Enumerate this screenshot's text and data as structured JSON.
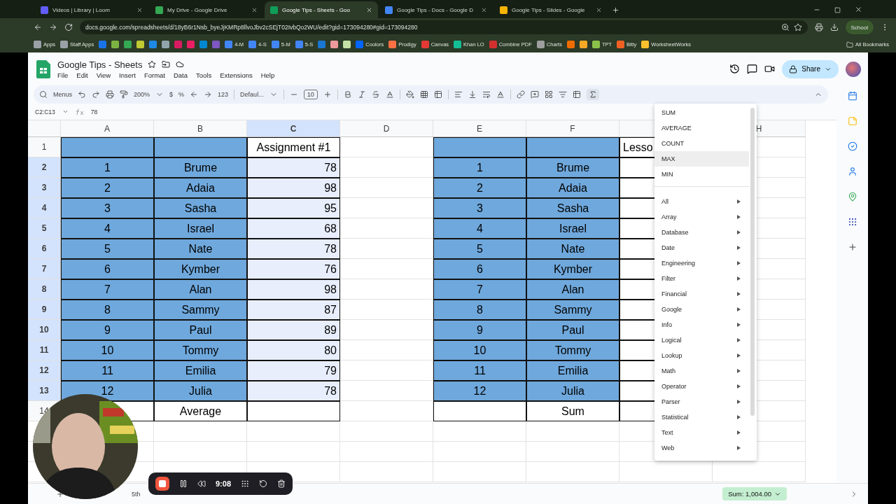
{
  "browser": {
    "tabs": [
      {
        "title": "Videos | Library | Loom",
        "selected": false,
        "color": "#625df5"
      },
      {
        "title": "My Drive - Google Drive",
        "selected": false,
        "color": "#34a853"
      },
      {
        "title": "Google Tips - Sheets - Goo",
        "selected": true,
        "color": "#0f9d58"
      },
      {
        "title": "Google Tips - Docs - Google D",
        "selected": false,
        "color": "#4285f4"
      },
      {
        "title": "Google Tips - Slides - Google",
        "selected": false,
        "color": "#f4b400"
      }
    ],
    "address": "docs.google.com/spreadsheets/d/18yB6r1Nsb_byeJjKMRp8llvoJbv2cSEjT02IvbQo2WU/edit?gid=173094280#gid=173094280",
    "profile": "School",
    "bookmarks": [
      {
        "kind": "link",
        "label": "Apps",
        "color": "#9aa0a6"
      },
      {
        "kind": "link",
        "label": "Staff Apps",
        "color": "#9aa0a6"
      },
      {
        "kind": "icon",
        "color": "#1a73e8"
      },
      {
        "kind": "icon",
        "color": "#7cb342"
      },
      {
        "kind": "icon",
        "color": "#34a853"
      },
      {
        "kind": "icon",
        "color": "#c0ca33"
      },
      {
        "kind": "icon",
        "color": "#1e88e5"
      },
      {
        "kind": "icon",
        "color": "#90a4ae"
      },
      {
        "kind": "icon",
        "color": "#d81b60"
      },
      {
        "kind": "icon",
        "color": "#e91e63"
      },
      {
        "kind": "icon",
        "color": "#0288d1"
      },
      {
        "kind": "icon",
        "color": "#7e57c2"
      },
      {
        "kind": "link",
        "label": "4-M",
        "color": "#4285f4"
      },
      {
        "kind": "link",
        "label": "4-S",
        "color": "#4285f4"
      },
      {
        "kind": "link",
        "label": "5-M",
        "color": "#4285f4"
      },
      {
        "kind": "link",
        "label": "5-S",
        "color": "#4285f4"
      },
      {
        "kind": "icon",
        "color": "#1976d2"
      },
      {
        "kind": "icon",
        "color": "#ef9a9a"
      },
      {
        "kind": "icon",
        "color": "#c5e1a5"
      },
      {
        "kind": "link",
        "label": "Coolors",
        "color": "#0066ff"
      },
      {
        "kind": "link",
        "label": "Prodigy",
        "color": "#ff7043"
      },
      {
        "kind": "link",
        "label": "Canvas",
        "color": "#e53935"
      },
      {
        "kind": "link",
        "label": "Khan LO",
        "color": "#14bf96"
      },
      {
        "kind": "link",
        "label": "Combine PDF",
        "color": "#d32f2f"
      },
      {
        "kind": "link",
        "label": "Charts",
        "color": "#9e9e9e"
      },
      {
        "kind": "icon",
        "color": "#ef6c00"
      },
      {
        "kind": "icon",
        "color": "#f9a825"
      },
      {
        "kind": "link",
        "label": "TPT",
        "color": "#8bc34a"
      },
      {
        "kind": "link",
        "label": "Bitly",
        "color": "#ee6123"
      },
      {
        "kind": "link",
        "label": "WorksheetWorks",
        "color": "#fbc02d"
      }
    ],
    "all_bookmarks": "All Bookmarks"
  },
  "sheets": {
    "title": "Google Tips - Sheets",
    "menus": [
      "File",
      "Edit",
      "View",
      "Insert",
      "Format",
      "Data",
      "Tools",
      "Extensions",
      "Help"
    ],
    "share": "Share",
    "toolbar": {
      "search": "Menus",
      "zoom": "200%",
      "currency": "$",
      "percent": "%",
      "number_format": "123",
      "font": "Defaul...",
      "font_size": "10"
    },
    "name_box": "C2:C13",
    "formula": "78",
    "columns": [
      {
        "label": "A",
        "selected": false
      },
      {
        "label": "B",
        "selected": false
      },
      {
        "label": "C",
        "selected": true
      },
      {
        "label": "D",
        "selected": false
      },
      {
        "label": "E",
        "selected": false
      },
      {
        "label": "F",
        "selected": false
      },
      {
        "selected": false
      },
      {
        "label": "H",
        "selected": false
      }
    ],
    "rows": [
      {
        "number": "1",
        "selected": false,
        "cells": [
          {
            "kind": "blue"
          },
          {
            "kind": "blue"
          },
          {
            "kind": "box",
            "text": "Assignment #1"
          },
          {
            "kind": "empty"
          },
          {
            "kind": "blue"
          },
          {
            "kind": "blue"
          },
          {
            "kind": "label",
            "text": "Lesso"
          },
          {
            "kind": "empty"
          }
        ]
      },
      {
        "number": "2",
        "selected": true,
        "cells": [
          {
            "kind": "blue",
            "text": "1"
          },
          {
            "kind": "blue",
            "text": "Brume"
          },
          {
            "kind": "sel",
            "text": "78"
          },
          {
            "kind": "empty"
          },
          {
            "kind": "blue",
            "text": "1"
          },
          {
            "kind": "blue",
            "text": "Brume"
          },
          {
            "kind": "box"
          },
          {
            "kind": "empty"
          }
        ]
      },
      {
        "number": "3",
        "selected": true,
        "cells": [
          {
            "kind": "blue",
            "text": "2"
          },
          {
            "kind": "blue",
            "text": "Adaia"
          },
          {
            "kind": "sel",
            "text": "98"
          },
          {
            "kind": "empty"
          },
          {
            "kind": "blue",
            "text": "2"
          },
          {
            "kind": "blue",
            "text": "Adaia"
          },
          {
            "kind": "box"
          },
          {
            "kind": "empty"
          }
        ]
      },
      {
        "number": "4",
        "selected": true,
        "cells": [
          {
            "kind": "blue",
            "text": "3"
          },
          {
            "kind": "blue",
            "text": "Sasha"
          },
          {
            "kind": "sel",
            "text": "95"
          },
          {
            "kind": "empty"
          },
          {
            "kind": "blue",
            "text": "3"
          },
          {
            "kind": "blue",
            "text": "Sasha"
          },
          {
            "kind": "box"
          },
          {
            "kind": "empty"
          }
        ]
      },
      {
        "number": "5",
        "selected": true,
        "cells": [
          {
            "kind": "blue",
            "text": "4"
          },
          {
            "kind": "blue",
            "text": "Israel"
          },
          {
            "kind": "sel",
            "text": "68"
          },
          {
            "kind": "empty"
          },
          {
            "kind": "blue",
            "text": "4"
          },
          {
            "kind": "blue",
            "text": "Israel"
          },
          {
            "kind": "box"
          },
          {
            "kind": "empty"
          }
        ]
      },
      {
        "number": "6",
        "selected": true,
        "cells": [
          {
            "kind": "blue",
            "text": "5"
          },
          {
            "kind": "blue",
            "text": "Nate"
          },
          {
            "kind": "sel",
            "text": "78"
          },
          {
            "kind": "empty"
          },
          {
            "kind": "blue",
            "text": "5"
          },
          {
            "kind": "blue",
            "text": "Nate"
          },
          {
            "kind": "box"
          },
          {
            "kind": "empty"
          }
        ]
      },
      {
        "number": "7",
        "selected": true,
        "cells": [
          {
            "kind": "blue",
            "text": "6"
          },
          {
            "kind": "blue",
            "text": "Kymber"
          },
          {
            "kind": "sel",
            "text": "76"
          },
          {
            "kind": "empty"
          },
          {
            "kind": "blue",
            "text": "6"
          },
          {
            "kind": "blue",
            "text": "Kymber"
          },
          {
            "kind": "box"
          },
          {
            "kind": "empty"
          }
        ]
      },
      {
        "number": "8",
        "selected": true,
        "cells": [
          {
            "kind": "blue",
            "text": "7"
          },
          {
            "kind": "blue",
            "text": "Alan"
          },
          {
            "kind": "sel",
            "text": "98"
          },
          {
            "kind": "empty"
          },
          {
            "kind": "blue",
            "text": "7"
          },
          {
            "kind": "blue",
            "text": "Alan"
          },
          {
            "kind": "box"
          },
          {
            "kind": "empty"
          }
        ]
      },
      {
        "number": "9",
        "selected": true,
        "cells": [
          {
            "kind": "blue",
            "text": "8"
          },
          {
            "kind": "blue",
            "text": "Sammy"
          },
          {
            "kind": "sel",
            "text": "87"
          },
          {
            "kind": "empty"
          },
          {
            "kind": "blue",
            "text": "8"
          },
          {
            "kind": "blue",
            "text": "Sammy"
          },
          {
            "kind": "box"
          },
          {
            "kind": "empty"
          }
        ]
      },
      {
        "number": "10",
        "selected": true,
        "cells": [
          {
            "kind": "blue",
            "text": "9"
          },
          {
            "kind": "blue",
            "text": "Paul"
          },
          {
            "kind": "sel",
            "text": "89"
          },
          {
            "kind": "empty"
          },
          {
            "kind": "blue",
            "text": "9"
          },
          {
            "kind": "blue",
            "text": "Paul"
          },
          {
            "kind": "box"
          },
          {
            "kind": "empty"
          }
        ]
      },
      {
        "number": "11",
        "selected": true,
        "cells": [
          {
            "kind": "blue",
            "text": "10"
          },
          {
            "kind": "blue",
            "text": "Tommy"
          },
          {
            "kind": "sel",
            "text": "80"
          },
          {
            "kind": "empty"
          },
          {
            "kind": "blue",
            "text": "10"
          },
          {
            "kind": "blue",
            "text": "Tommy"
          },
          {
            "kind": "box"
          },
          {
            "kind": "empty"
          }
        ]
      },
      {
        "number": "12",
        "selected": true,
        "cells": [
          {
            "kind": "blue",
            "text": "11"
          },
          {
            "kind": "blue",
            "text": "Emilia"
          },
          {
            "kind": "sel",
            "text": "79"
          },
          {
            "kind": "empty"
          },
          {
            "kind": "blue",
            "text": "11"
          },
          {
            "kind": "blue",
            "text": "Emilia"
          },
          {
            "kind": "box"
          },
          {
            "kind": "empty"
          }
        ]
      },
      {
        "number": "13",
        "selected": true,
        "cells": [
          {
            "kind": "blue",
            "text": "12"
          },
          {
            "kind": "blue",
            "text": "Julia"
          },
          {
            "kind": "sel",
            "text": "78"
          },
          {
            "kind": "empty"
          },
          {
            "kind": "blue",
            "text": "12"
          },
          {
            "kind": "blue",
            "text": "Julia"
          },
          {
            "kind": "box"
          },
          {
            "kind": "empty"
          }
        ]
      },
      {
        "number": "14",
        "selected": false,
        "cells": [
          {
            "kind": "box"
          },
          {
            "kind": "box",
            "text": "Average"
          },
          {
            "kind": "box"
          },
          {
            "kind": "empty"
          },
          {
            "kind": "box"
          },
          {
            "kind": "box",
            "text": "Sum"
          },
          {
            "kind": "box"
          },
          {
            "kind": "empty"
          }
        ]
      }
    ],
    "function_menu": [
      {
        "kind": "function",
        "label": "SUM",
        "selected": false
      },
      {
        "kind": "function",
        "label": "AVERAGE",
        "selected": false
      },
      {
        "kind": "function",
        "label": "COUNT",
        "selected": false
      },
      {
        "kind": "function",
        "label": "MAX",
        "selected": true
      },
      {
        "kind": "function",
        "label": "MIN",
        "selected": false
      },
      {
        "kind": "category",
        "label": "All",
        "selected": false
      },
      {
        "kind": "category",
        "label": "Array",
        "selected": false
      },
      {
        "kind": "category",
        "label": "Database",
        "selected": false
      },
      {
        "kind": "category",
        "label": "Date",
        "selected": false
      },
      {
        "kind": "category",
        "label": "Engineering",
        "selected": false
      },
      {
        "kind": "category",
        "label": "Filter",
        "selected": false
      },
      {
        "kind": "category",
        "label": "Financial",
        "selected": false
      },
      {
        "kind": "category",
        "label": "Google",
        "selected": false
      },
      {
        "kind": "category",
        "label": "Info",
        "selected": false
      },
      {
        "kind": "category",
        "label": "Logical",
        "selected": false
      },
      {
        "kind": "category",
        "label": "Lookup",
        "selected": false
      },
      {
        "kind": "category",
        "label": "Math",
        "selected": false
      },
      {
        "kind": "category",
        "label": "Operator",
        "selected": false
      },
      {
        "kind": "category",
        "label": "Parser",
        "selected": false
      },
      {
        "kind": "category",
        "label": "Statistical",
        "selected": false
      },
      {
        "kind": "category",
        "label": "Text",
        "selected": false
      },
      {
        "kind": "category",
        "label": "Web",
        "selected": false
      }
    ],
    "sheet_tabs": [
      {
        "label": "5th",
        "selected": false
      }
    ],
    "sum": "Sum: 1,004.00"
  },
  "recorder": {
    "time": "9:08"
  }
}
